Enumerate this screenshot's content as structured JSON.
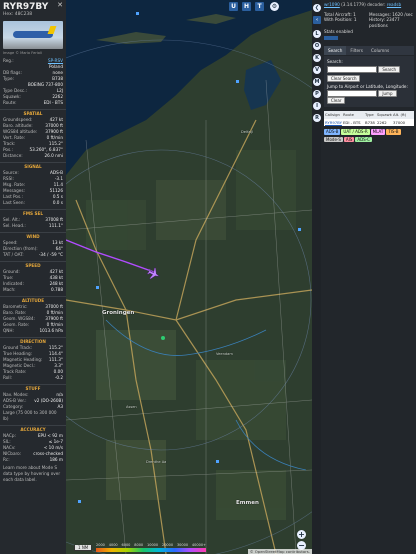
{
  "aircraft": {
    "callsign": "RYR97BY",
    "hex_label": "Hex:",
    "hex": "48C238",
    "close": "✕",
    "photo_credit": "Image © Mario Ferioli",
    "fields": [
      {
        "k": "Reg.:",
        "v": "SP-RSV",
        "link": true
      },
      {
        "k": "",
        "v": "Poland"
      },
      {
        "k": "DB flags:",
        "v": "none"
      },
      {
        "k": "Type:",
        "v": "B738"
      },
      {
        "k": "",
        "v": "BOEING 737-800"
      },
      {
        "k": "Type Desc.:",
        "v": "L2J"
      },
      {
        "k": "Squawk:",
        "v": "2262"
      },
      {
        "k": "Route:",
        "v": "EDI - BTS"
      }
    ],
    "sections": [
      {
        "title": "SPATIAL",
        "rows": [
          {
            "k": "Groundspeed:",
            "v": "427 kt"
          },
          {
            "k": "Baro. altitude:",
            "v": "37000 ft"
          },
          {
            "k": "WGS84 altitude:",
            "v": "37900 ft"
          },
          {
            "k": "Vert. Rate:",
            "v": "0 ft/min"
          },
          {
            "k": "Track:",
            "v": "115.2°"
          },
          {
            "k": "Pos.:",
            "v": "53.260°, 6.837°"
          },
          {
            "k": "Distance:",
            "v": "26.0 nmi"
          }
        ]
      },
      {
        "title": "SIGNAL",
        "rows": [
          {
            "k": "Source:",
            "v": "ADS-B"
          },
          {
            "k": "RSSI:",
            "v": "-3.1"
          },
          {
            "k": "Msg. Rate:",
            "v": "11.4"
          },
          {
            "k": "Messages:",
            "v": "51126"
          },
          {
            "k": "Last Pos.:",
            "v": "0.5 s"
          },
          {
            "k": "Last Seen:",
            "v": "0.0 s"
          }
        ]
      },
      {
        "title": "FMS SEL",
        "rows": [
          {
            "k": "Sel. Alt.:",
            "v": "37008 ft"
          },
          {
            "k": "Sel. Head.:",
            "v": "111.1°"
          }
        ]
      },
      {
        "title": "WIND",
        "rows": [
          {
            "k": "Speed:",
            "v": "13 kt"
          },
          {
            "k": "Direction (from):",
            "v": "64°"
          },
          {
            "k": "TAT / OAT:",
            "v": "-34 / -59 °C"
          }
        ]
      },
      {
        "title": "SPEED",
        "rows": [
          {
            "k": "Ground:",
            "v": "427 kt"
          },
          {
            "k": "True:",
            "v": "438 kt"
          },
          {
            "k": "Indicated:",
            "v": "248 kt"
          },
          {
            "k": "Mach:",
            "v": "0.788"
          }
        ]
      },
      {
        "title": "ALTITUDE",
        "rows": [
          {
            "k": "Barometric:",
            "v": "37000 ft"
          },
          {
            "k": "Baro. Rate:",
            "v": "0 ft/min"
          },
          {
            "k": "Geom. WGS84:",
            "v": "37900 ft"
          },
          {
            "k": "Geom. Rate:",
            "v": "0 ft/min"
          },
          {
            "k": "QNH:",
            "v": "1013.6 hPa"
          }
        ]
      },
      {
        "title": "DIRECTION",
        "rows": [
          {
            "k": "Ground Track:",
            "v": "115.2°"
          },
          {
            "k": "True Heading:",
            "v": "114.4°"
          },
          {
            "k": "Magnetic Heading:",
            "v": "111.3°"
          },
          {
            "k": "Magnetic Decl.:",
            "v": "3.3°"
          },
          {
            "k": "Track Rate:",
            "v": "0.00"
          },
          {
            "k": "Roll:",
            "v": "-0.2"
          }
        ]
      },
      {
        "title": "STUFF",
        "rows": [
          {
            "k": "Nav. Modes:",
            "v": "n/a"
          },
          {
            "k": "ADS-B Ver.:",
            "v": "v2 (DO-260B)"
          },
          {
            "k": "Category:",
            "v": "A3"
          },
          {
            "k": "Large (75 000 to 300 000 lb)",
            "v": ""
          }
        ]
      },
      {
        "title": "ACCURACY",
        "rows": [
          {
            "k": "NACp:",
            "v": "EPU < 92 m"
          },
          {
            "k": "SIL:",
            "v": "≤ 1e-7"
          },
          {
            "k": "NACv:",
            "v": "< 10 m/s"
          },
          {
            "k": "NICbaro:",
            "v": "cross-checked"
          },
          {
            "k": "Rc:",
            "v": "186 m"
          }
        ]
      }
    ],
    "footnote": "Learn more about Mode S data type by hovering over each data label."
  },
  "map": {
    "top_buttons": [
      "U",
      "H",
      "T"
    ],
    "scale": "1 NM",
    "attribution": "© OpenStreetMap contributors.",
    "color_scale_labels": [
      "2000",
      "4000",
      "6000",
      "8000",
      "10000",
      "20000",
      "30000",
      "40000+"
    ],
    "zoom_in": "+",
    "zoom_out": "−",
    "labels": [
      {
        "text": "Groningen",
        "cls": "city"
      },
      {
        "text": "Emmen",
        "cls": "city"
      },
      {
        "text": "Drenthe Aa",
        "cls": "small"
      },
      {
        "text": "Veendam",
        "cls": "small"
      },
      {
        "text": "Assen",
        "cls": "small"
      },
      {
        "text": "Delfzijl",
        "cls": "small"
      }
    ]
  },
  "right": {
    "side_buttons": [
      "L",
      "O",
      "K",
      "V",
      "M",
      "P",
      "I",
      "R"
    ],
    "version_link": "wr1090",
    "version": "(3.14.1779)",
    "decoder_label": "decoder:",
    "decoder_value": "readsb",
    "stats": [
      {
        "k": "Total Aircraft:",
        "v": "1"
      },
      {
        "k": "Messages:",
        "v": "1620 /sec"
      },
      {
        "k": "With Position:",
        "v": "1"
      },
      {
        "k": "History:",
        "v": "23477 positions"
      }
    ],
    "stats_label": "Stats enabled",
    "tabs": [
      "Search",
      "Filters",
      "Columns"
    ],
    "search_label": "Search:",
    "search_button": "Search",
    "clear_search": "Clear Search",
    "jump_label": "Jump to Airport or Latitude, Longitude:",
    "jump_button": "Jump",
    "clear_button": "Clear",
    "columns": [
      "Callsign",
      "Route",
      "Type",
      "Squawk",
      "Alt. (ft)"
    ],
    "row": {
      "callsign": "RYR97BY",
      "route": "EDI - BTS",
      "type": "B738",
      "squawk": "2262",
      "alt": "37000"
    },
    "legend_tags": [
      {
        "label": "ADS-B",
        "color": "#7fb5ff"
      },
      {
        "label": "UAT / ADS-R",
        "color": "#c6ff9b"
      },
      {
        "label": "MLAT",
        "color": "#ffa0ff"
      },
      {
        "label": "TIS-B",
        "color": "#ffb45a"
      },
      {
        "label": "Mode-S",
        "color": "#c8c8c8"
      },
      {
        "label": "AIS",
        "color": "#ff8fa0"
      },
      {
        "label": "ADS-C",
        "color": "#9ff0a0"
      }
    ]
  }
}
